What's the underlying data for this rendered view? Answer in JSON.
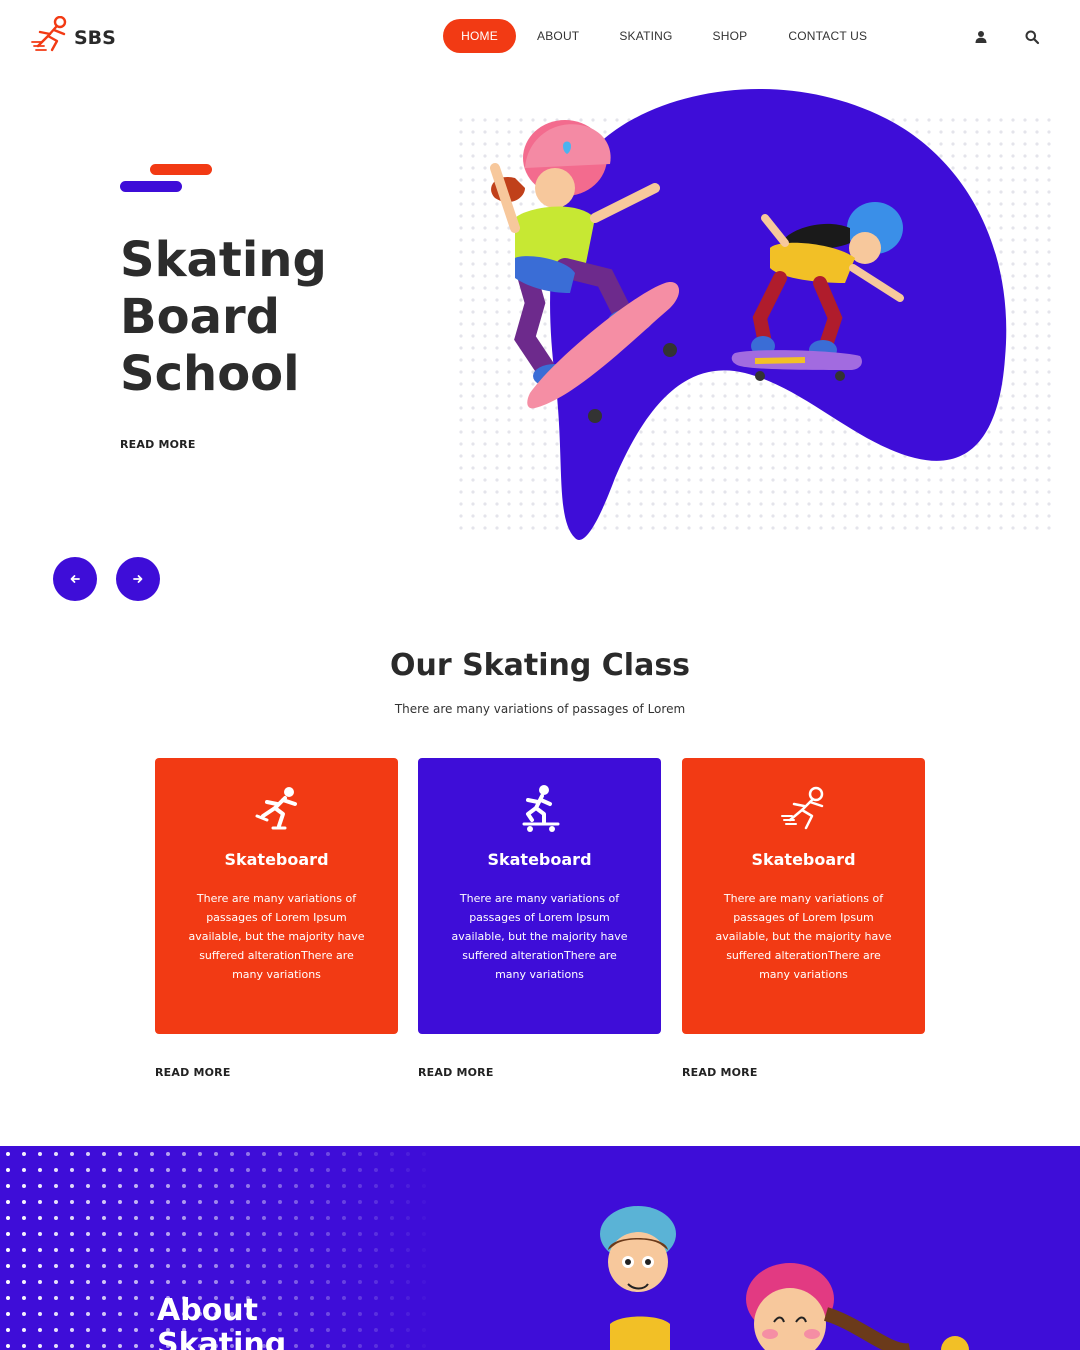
{
  "header": {
    "logo_text": "SBS",
    "nav": [
      {
        "label": "HOME"
      },
      {
        "label": "ABOUT"
      },
      {
        "label": "SKATING"
      },
      {
        "label": "SHOP"
      },
      {
        "label": "CONTACT US"
      }
    ],
    "icons": [
      "user-icon",
      "search-icon"
    ]
  },
  "hero": {
    "title": "Skating\nBoard\nSchool",
    "read_more": "READ MORE",
    "nav_icons": [
      "arrow-left-icon",
      "arrow-right-icon"
    ]
  },
  "classes": {
    "title": "Our Skating Class",
    "subtitle": "There are many variations of passages of Lorem",
    "cards": [
      {
        "title": "Skateboard",
        "text": "There are many variations of passages of Lorem Ipsum available, but the majority have suffered alterationThere are many variations",
        "read_more": "READ MORE",
        "color": "#f23a14",
        "icon": "skater-icon"
      },
      {
        "title": "Skateboard",
        "text": "There are many variations of passages of Lorem Ipsum available, but the majority have suffered alterationThere are many variations",
        "read_more": "READ MORE",
        "color": "#3e0dd8",
        "icon": "skateboarder-icon"
      },
      {
        "title": "Skateboard",
        "text": "There are many variations of passages of Lorem Ipsum available, but the majority have suffered alterationThere are many variations",
        "read_more": "READ MORE",
        "color": "#f23a14",
        "icon": "skater-icon"
      }
    ]
  },
  "about": {
    "title": "About\nSkating"
  },
  "colors": {
    "accent_orange": "#f23a14",
    "accent_purple": "#3e0dd8",
    "text_dark": "#2c2c2c"
  }
}
